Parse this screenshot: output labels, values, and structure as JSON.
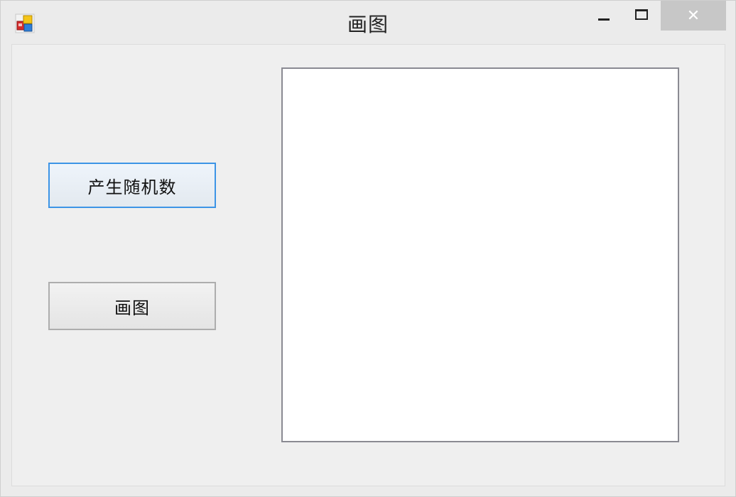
{
  "window": {
    "title": "画图",
    "controls": {
      "minimize_icon": "minimize-icon",
      "maximize_icon": "maximize-icon",
      "close_glyph": "✕"
    }
  },
  "buttons": {
    "generate_random_label": "产生随机数",
    "draw_label": "画图"
  },
  "colors": {
    "focus_border": "#3c94e6",
    "close_button_bg": "#c7c7c7",
    "canvas_bg": "#ffffff"
  }
}
